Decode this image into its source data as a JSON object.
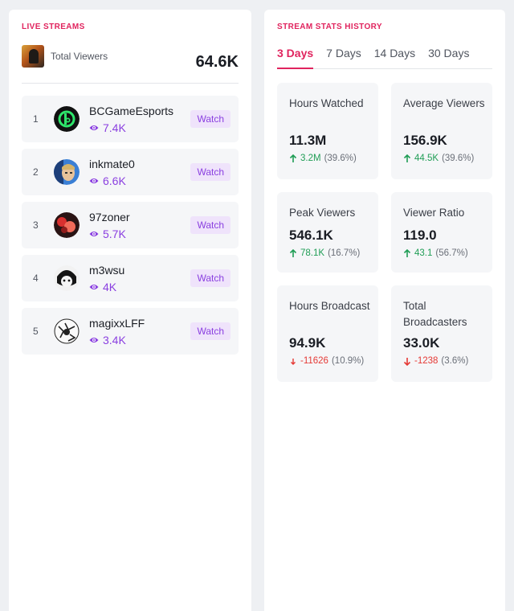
{
  "live_streams": {
    "title": "LIVE STREAMS",
    "total_label": "Total Viewers",
    "total_value": "64.6K",
    "watch_label": "Watch",
    "streams": [
      {
        "rank": "1",
        "name": "BCGameEsports",
        "viewers": "7.4K"
      },
      {
        "rank": "2",
        "name": "inkmate0",
        "viewers": "6.6K"
      },
      {
        "rank": "3",
        "name": "97zoner",
        "viewers": "5.7K"
      },
      {
        "rank": "4",
        "name": "m3wsu",
        "viewers": "4K"
      },
      {
        "rank": "5",
        "name": "magixxLFF",
        "viewers": "3.4K"
      }
    ]
  },
  "stats_history": {
    "title": "STREAM STATS HISTORY",
    "tabs": [
      "3 Days",
      "7 Days",
      "14 Days",
      "30 Days"
    ],
    "active_tab": "3 Days",
    "cards": [
      {
        "label": "Hours Watched",
        "value": "11.3M",
        "delta": "3.2M",
        "pct": "(39.6%)",
        "direction": "up"
      },
      {
        "label": "Average Viewers",
        "value": "156.9K",
        "delta": "44.5K",
        "pct": "(39.6%)",
        "direction": "up"
      },
      {
        "label": "Peak Viewers",
        "value": "546.1K",
        "delta": "78.1K",
        "pct": "(16.7%)",
        "direction": "up"
      },
      {
        "label": "Viewer Ratio",
        "value": "119.0",
        "delta": "43.1",
        "pct": "(56.7%)",
        "direction": "up"
      },
      {
        "label": "Hours Broadcast",
        "value": "94.9K",
        "delta": "-11626",
        "pct": "(10.9%)",
        "direction": "down"
      },
      {
        "label": "Total Broadcasters",
        "value": "33.0K",
        "delta": "-1238",
        "pct": "(3.6%)",
        "direction": "down"
      }
    ]
  },
  "colors": {
    "accent": "#e0245e",
    "purple": "#8a3fe0",
    "up": "#1f9d55",
    "down": "#e53935"
  }
}
